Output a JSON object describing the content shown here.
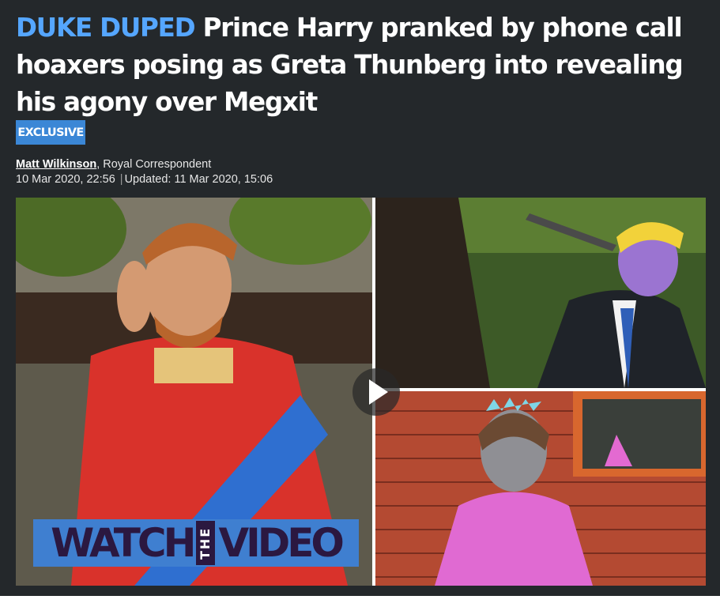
{
  "article": {
    "kicker": "DUKE DUPED",
    "headline": "Prince Harry pranked by phone call hoaxers posing as Greta Thunberg into revealing his agony over Megxit",
    "badge": "EXCLUSIVE",
    "byline": {
      "author": "Matt Wilkinson",
      "role": ", Royal Correspondent",
      "published": "10 Mar 2020, 22:56",
      "separator": "|",
      "updated": "Updated: 11 Mar 2020, 15:06"
    }
  },
  "video": {
    "overlay": {
      "watch": "WATCH",
      "the": "THE",
      "video": "VIDEO"
    },
    "play_icon": "play-icon"
  },
  "colors": {
    "panel_bg": "#24282b",
    "kicker": "#55a6ff",
    "badge_bg": "#3b87d6",
    "overlay_bg": "#3f7fd0"
  }
}
